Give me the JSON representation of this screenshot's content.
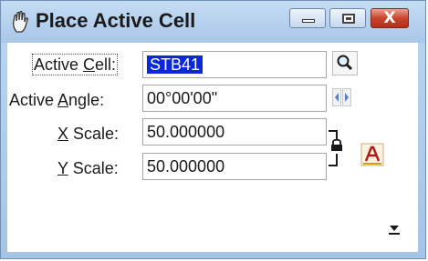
{
  "window": {
    "title": "Place Active Cell",
    "close_label": "X"
  },
  "fields": {
    "active_cell": {
      "label_pre": "Active ",
      "label_key": "C",
      "label_post": "ell:",
      "value": "STB41"
    },
    "active_angle": {
      "label_pre": "Active ",
      "label_key": "A",
      "label_post": "ngle:",
      "value": "00°00'00\""
    },
    "x_scale": {
      "label_key": "X",
      "label_post": " Scale:",
      "value": "50.000000"
    },
    "y_scale": {
      "label_key": "Y",
      "label_post": " Scale:",
      "value": "50.000000"
    }
  },
  "icons": {
    "browse": "magnifier-icon",
    "spin": "spin-arrows-icon",
    "lock": "lock-icon",
    "text_style": "text-style-A-icon",
    "expand": "expand-arrow-icon",
    "app": "hand-icon"
  },
  "colors": {
    "title_bar": "#b3cdea",
    "selection": "#0b27dd",
    "close_button": "#c9432c"
  }
}
